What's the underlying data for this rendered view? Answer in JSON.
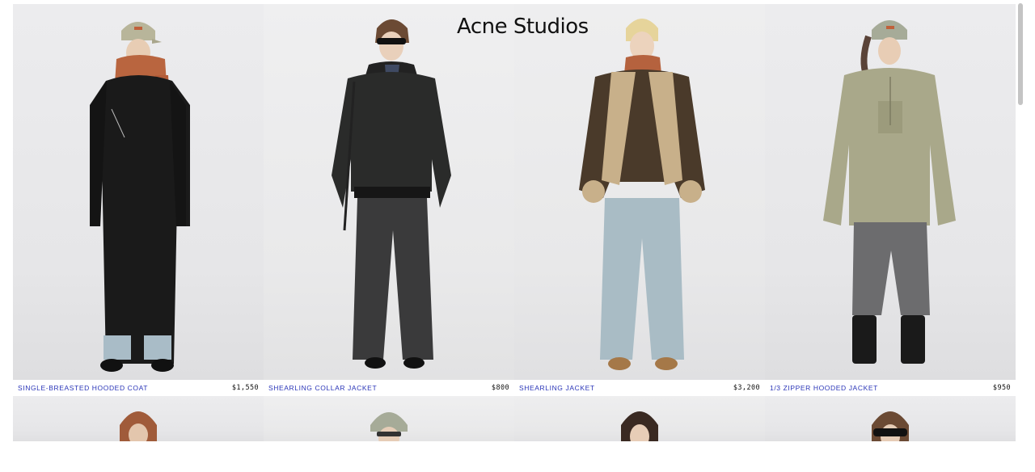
{
  "header": {
    "logo_text": "Acne Studios"
  },
  "products_row1": [
    {
      "name": "SINGLE-BREASTED HOODED COAT",
      "price": "$1,550"
    },
    {
      "name": "SHEARLING COLLAR JACKET",
      "price": "$800"
    },
    {
      "name": "SHEARLING JACKET",
      "price": "$3,200"
    },
    {
      "name": "1/3 ZIPPER HOODED JACKET",
      "price": "$950"
    }
  ],
  "colors": {
    "product_link": "#2a35b8",
    "price_text": "#111111",
    "photo_bg": "#e8e8ea"
  }
}
